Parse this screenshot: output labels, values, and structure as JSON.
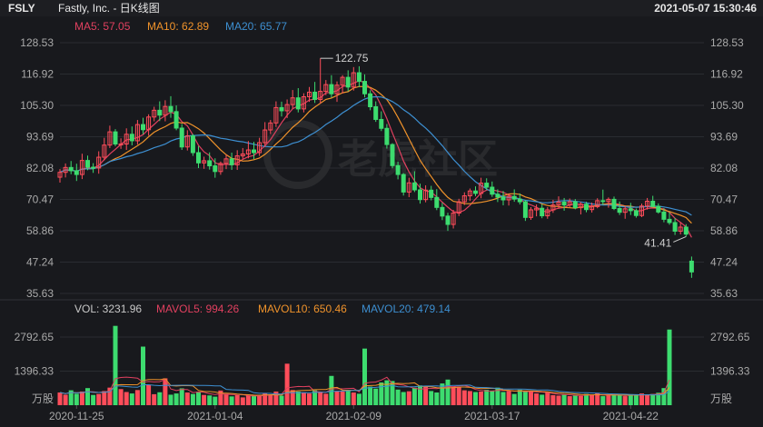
{
  "header": {
    "symbol": "FSLY",
    "title": "Fastly, Inc. - 日K线图",
    "datetime": "2021-05-07 15:30:46"
  },
  "price_legend": [
    {
      "label": "MA5: 57.05",
      "color": "#e0405f"
    },
    {
      "label": "MA10: 62.89",
      "color": "#f0932b"
    },
    {
      "label": "MA20: 65.77",
      "color": "#3d8fd1"
    }
  ],
  "volume_legend": [
    {
      "label": "VOL: 3231.96",
      "color": "#c8c8c8"
    },
    {
      "label": "MAVOL5: 994.26",
      "color": "#e0405f"
    },
    {
      "label": "MAVOL10: 650.46",
      "color": "#f0932b"
    },
    {
      "label": "MAVOL20: 479.14",
      "color": "#3d8fd1"
    }
  ],
  "watermark": "老虎社区",
  "colors": {
    "up": "#ff4d5a",
    "down": "#3ddc6f",
    "grid": "#2a2c31",
    "bg": "#18191d"
  },
  "chart_data": {
    "type": "candlestick",
    "title": "Fastly, Inc. - 日K线图",
    "price_axis": {
      "ticks": [
        "128.53",
        "116.92",
        "105.30",
        "93.69",
        "82.08",
        "70.47",
        "58.86",
        "47.24",
        "35.63"
      ],
      "range": [
        35.63,
        128.53
      ]
    },
    "volume_axis": {
      "ticks": [
        "2792.65",
        "1396.33"
      ],
      "unit": "万股",
      "range": [
        0,
        3350
      ]
    },
    "date_ticks": [
      {
        "index": 3,
        "label": "2020-11-25"
      },
      {
        "index": 28,
        "label": "2021-01-04"
      },
      {
        "index": 53,
        "label": "2021-02-09"
      },
      {
        "index": 78,
        "label": "2021-03-17"
      },
      {
        "index": 103,
        "label": "2021-04-22"
      }
    ],
    "annotations": {
      "high": {
        "index": 47,
        "label": "122.75"
      },
      "low": {
        "index": 113,
        "label": "41.41"
      }
    },
    "candles": [
      {
        "o": 78.7,
        "h": 81.7,
        "l": 76.7,
        "c": 80.5
      },
      {
        "o": 80.5,
        "h": 83.8,
        "l": 78.6,
        "c": 82.3
      },
      {
        "o": 82.3,
        "h": 84.7,
        "l": 79.8,
        "c": 81.1
      },
      {
        "o": 81.1,
        "h": 83.7,
        "l": 77.3,
        "c": 79.7
      },
      {
        "o": 79.7,
        "h": 87.4,
        "l": 78.0,
        "c": 84.9
      },
      {
        "o": 84.9,
        "h": 86.7,
        "l": 81.3,
        "c": 82.4
      },
      {
        "o": 82.4,
        "h": 83.9,
        "l": 80.3,
        "c": 82.1
      },
      {
        "o": 82.1,
        "h": 88.3,
        "l": 80.0,
        "c": 86.1
      },
      {
        "o": 86.1,
        "h": 93.3,
        "l": 85.0,
        "c": 90.6
      },
      {
        "o": 90.6,
        "h": 97.8,
        "l": 89.5,
        "c": 95.5
      },
      {
        "o": 95.5,
        "h": 96.5,
        "l": 90.2,
        "c": 91.0
      },
      {
        "o": 91.0,
        "h": 93.1,
        "l": 89.2,
        "c": 91.0
      },
      {
        "o": 91.0,
        "h": 96.8,
        "l": 88.8,
        "c": 94.6
      },
      {
        "o": 94.6,
        "h": 97.5,
        "l": 90.5,
        "c": 92.2
      },
      {
        "o": 92.2,
        "h": 99.9,
        "l": 90.8,
        "c": 98.2
      },
      {
        "o": 98.2,
        "h": 100.7,
        "l": 94.6,
        "c": 96.3
      },
      {
        "o": 96.3,
        "h": 102.0,
        "l": 94.1,
        "c": 101.0
      },
      {
        "o": 101.0,
        "h": 104.8,
        "l": 99.4,
        "c": 103.5
      },
      {
        "o": 103.5,
        "h": 106.8,
        "l": 99.5,
        "c": 101.7
      },
      {
        "o": 101.7,
        "h": 107.2,
        "l": 99.4,
        "c": 104.9
      },
      {
        "o": 104.9,
        "h": 108.7,
        "l": 100.7,
        "c": 103.0
      },
      {
        "o": 103.0,
        "h": 105.3,
        "l": 96.1,
        "c": 96.9
      },
      {
        "o": 96.9,
        "h": 98.4,
        "l": 88.8,
        "c": 89.9
      },
      {
        "o": 89.9,
        "h": 96.1,
        "l": 88.6,
        "c": 94.0
      },
      {
        "o": 94.0,
        "h": 94.7,
        "l": 86.6,
        "c": 87.8
      },
      {
        "o": 87.8,
        "h": 90.2,
        "l": 82.1,
        "c": 84.0
      },
      {
        "o": 84.0,
        "h": 86.3,
        "l": 81.8,
        "c": 84.8
      },
      {
        "o": 84.8,
        "h": 87.9,
        "l": 81.5,
        "c": 82.9
      },
      {
        "o": 82.9,
        "h": 85.7,
        "l": 78.5,
        "c": 80.8
      },
      {
        "o": 80.8,
        "h": 84.5,
        "l": 79.6,
        "c": 83.8
      },
      {
        "o": 83.8,
        "h": 87.0,
        "l": 81.7,
        "c": 85.5
      },
      {
        "o": 85.5,
        "h": 87.8,
        "l": 81.4,
        "c": 83.3
      },
      {
        "o": 83.3,
        "h": 88.7,
        "l": 81.4,
        "c": 86.6
      },
      {
        "o": 86.6,
        "h": 89.5,
        "l": 85.5,
        "c": 87.3
      },
      {
        "o": 87.3,
        "h": 92.1,
        "l": 85.7,
        "c": 88.8
      },
      {
        "o": 88.8,
        "h": 91.8,
        "l": 85.4,
        "c": 87.8
      },
      {
        "o": 87.8,
        "h": 93.3,
        "l": 86.6,
        "c": 91.5
      },
      {
        "o": 91.5,
        "h": 99.1,
        "l": 89.9,
        "c": 96.2
      },
      {
        "o": 96.2,
        "h": 99.9,
        "l": 94.7,
        "c": 98.8
      },
      {
        "o": 98.8,
        "h": 106.8,
        "l": 97.3,
        "c": 104.5
      },
      {
        "o": 104.5,
        "h": 106.7,
        "l": 101.2,
        "c": 103.3
      },
      {
        "o": 103.3,
        "h": 107.5,
        "l": 100.6,
        "c": 105.6
      },
      {
        "o": 105.6,
        "h": 111.0,
        "l": 104.1,
        "c": 108.1
      },
      {
        "o": 108.1,
        "h": 111.7,
        "l": 102.7,
        "c": 104.0
      },
      {
        "o": 104.0,
        "h": 109.8,
        "l": 102.7,
        "c": 108.5
      },
      {
        "o": 108.5,
        "h": 112.1,
        "l": 106.6,
        "c": 110.2
      },
      {
        "o": 110.2,
        "h": 114.0,
        "l": 106.2,
        "c": 107.5
      },
      {
        "o": 107.5,
        "h": 122.75,
        "l": 106.0,
        "c": 110.5
      },
      {
        "o": 110.5,
        "h": 114.7,
        "l": 109.1,
        "c": 113.0
      },
      {
        "o": 113.0,
        "h": 116.5,
        "l": 108.2,
        "c": 109.6
      },
      {
        "o": 109.6,
        "h": 114.2,
        "l": 106.6,
        "c": 112.8
      },
      {
        "o": 112.8,
        "h": 116.5,
        "l": 109.7,
        "c": 115.7
      },
      {
        "o": 115.7,
        "h": 118.3,
        "l": 110.5,
        "c": 112.1
      },
      {
        "o": 112.1,
        "h": 119.5,
        "l": 110.8,
        "c": 117.4
      },
      {
        "o": 117.4,
        "h": 119.8,
        "l": 112.1,
        "c": 114.2
      },
      {
        "o": 114.2,
        "h": 116.8,
        "l": 108.3,
        "c": 109.6
      },
      {
        "o": 109.6,
        "h": 110.9,
        "l": 103.5,
        "c": 104.8
      },
      {
        "o": 104.8,
        "h": 106.8,
        "l": 99.2,
        "c": 100.1
      },
      {
        "o": 100.1,
        "h": 103.1,
        "l": 95.8,
        "c": 96.8
      },
      {
        "o": 96.8,
        "h": 98.4,
        "l": 89.3,
        "c": 90.8
      },
      {
        "o": 90.8,
        "h": 91.3,
        "l": 82.0,
        "c": 83.0
      },
      {
        "o": 83.0,
        "h": 84.5,
        "l": 77.9,
        "c": 79.7
      },
      {
        "o": 79.7,
        "h": 80.2,
        "l": 71.9,
        "c": 73.2
      },
      {
        "o": 73.2,
        "h": 78.5,
        "l": 71.3,
        "c": 76.6
      },
      {
        "o": 76.6,
        "h": 80.9,
        "l": 73.2,
        "c": 74.0
      },
      {
        "o": 74.0,
        "h": 76.3,
        "l": 68.9,
        "c": 70.4
      },
      {
        "o": 70.4,
        "h": 75.7,
        "l": 69.4,
        "c": 73.9
      },
      {
        "o": 73.9,
        "h": 75.5,
        "l": 70.1,
        "c": 71.2
      },
      {
        "o": 71.2,
        "h": 74.3,
        "l": 66.5,
        "c": 67.5
      },
      {
        "o": 67.5,
        "h": 69.2,
        "l": 62.8,
        "c": 64.3
      },
      {
        "o": 64.3,
        "h": 65.5,
        "l": 58.8,
        "c": 61.2
      },
      {
        "o": 61.2,
        "h": 66.6,
        "l": 59.7,
        "c": 65.4
      },
      {
        "o": 65.4,
        "h": 70.7,
        "l": 64.3,
        "c": 69.6
      },
      {
        "o": 69.6,
        "h": 73.1,
        "l": 68.4,
        "c": 71.8
      },
      {
        "o": 71.8,
        "h": 74.5,
        "l": 69.9,
        "c": 73.6
      },
      {
        "o": 73.6,
        "h": 75.3,
        "l": 71.7,
        "c": 72.7
      },
      {
        "o": 72.7,
        "h": 78.5,
        "l": 70.9,
        "c": 76.5
      },
      {
        "o": 76.5,
        "h": 78.3,
        "l": 73.9,
        "c": 75.0
      },
      {
        "o": 75.0,
        "h": 77.1,
        "l": 71.4,
        "c": 72.4
      },
      {
        "o": 72.4,
        "h": 74.2,
        "l": 69.5,
        "c": 71.3
      },
      {
        "o": 71.3,
        "h": 73.6,
        "l": 68.3,
        "c": 70.3
      },
      {
        "o": 70.3,
        "h": 72.5,
        "l": 68.2,
        "c": 71.6
      },
      {
        "o": 71.6,
        "h": 74.2,
        "l": 69.6,
        "c": 70.6
      },
      {
        "o": 70.6,
        "h": 72.7,
        "l": 68.6,
        "c": 69.6
      },
      {
        "o": 69.6,
        "h": 70.3,
        "l": 62.5,
        "c": 63.8
      },
      {
        "o": 63.8,
        "h": 67.6,
        "l": 62.9,
        "c": 66.6
      },
      {
        "o": 66.6,
        "h": 68.6,
        "l": 64.2,
        "c": 67.2
      },
      {
        "o": 67.2,
        "h": 68.7,
        "l": 63.5,
        "c": 64.4
      },
      {
        "o": 64.4,
        "h": 67.6,
        "l": 63.3,
        "c": 66.6
      },
      {
        "o": 66.6,
        "h": 70.3,
        "l": 65.5,
        "c": 68.4
      },
      {
        "o": 68.4,
        "h": 71.6,
        "l": 67.0,
        "c": 69.5
      },
      {
        "o": 69.5,
        "h": 71.0,
        "l": 66.3,
        "c": 68.4
      },
      {
        "o": 68.4,
        "h": 70.8,
        "l": 67.4,
        "c": 69.6
      },
      {
        "o": 69.6,
        "h": 70.6,
        "l": 66.8,
        "c": 67.4
      },
      {
        "o": 67.4,
        "h": 69.5,
        "l": 64.9,
        "c": 68.7
      },
      {
        "o": 68.7,
        "h": 69.6,
        "l": 65.7,
        "c": 66.7
      },
      {
        "o": 66.7,
        "h": 69.3,
        "l": 65.6,
        "c": 67.8
      },
      {
        "o": 67.8,
        "h": 70.9,
        "l": 67.2,
        "c": 70.0
      },
      {
        "o": 70.0,
        "h": 74.1,
        "l": 68.4,
        "c": 69.7
      },
      {
        "o": 69.7,
        "h": 71.2,
        "l": 67.4,
        "c": 70.5
      },
      {
        "o": 70.5,
        "h": 71.5,
        "l": 66.5,
        "c": 67.1
      },
      {
        "o": 67.1,
        "h": 69.7,
        "l": 64.7,
        "c": 65.7
      },
      {
        "o": 65.7,
        "h": 68.2,
        "l": 63.3,
        "c": 67.0
      },
      {
        "o": 67.0,
        "h": 69.2,
        "l": 64.7,
        "c": 66.3
      },
      {
        "o": 66.3,
        "h": 67.1,
        "l": 63.7,
        "c": 64.5
      },
      {
        "o": 64.5,
        "h": 68.9,
        "l": 63.9,
        "c": 68.0
      },
      {
        "o": 68.0,
        "h": 71.0,
        "l": 66.7,
        "c": 69.8
      },
      {
        "o": 69.8,
        "h": 71.8,
        "l": 67.5,
        "c": 67.9
      },
      {
        "o": 67.9,
        "h": 69.0,
        "l": 65.2,
        "c": 65.8
      },
      {
        "o": 65.8,
        "h": 67.2,
        "l": 62.0,
        "c": 63.1
      },
      {
        "o": 63.1,
        "h": 65.7,
        "l": 61.1,
        "c": 61.9
      },
      {
        "o": 61.9,
        "h": 63.6,
        "l": 57.3,
        "c": 58.7
      },
      {
        "o": 58.7,
        "h": 62.0,
        "l": 57.5,
        "c": 60.2
      },
      {
        "o": 60.2,
        "h": 61.3,
        "l": 56.7,
        "c": 57.6
      },
      {
        "o": 47.6,
        "h": 49.3,
        "l": 41.41,
        "c": 43.6
      }
    ],
    "volume": [
      520,
      430,
      610,
      470,
      560,
      700,
      420,
      460,
      580,
      720,
      3250,
      660,
      540,
      480,
      620,
      2400,
      820,
      450,
      530,
      1100,
      430,
      480,
      690,
      520,
      460,
      550,
      420,
      400,
      350,
      600,
      470,
      360,
      410,
      320,
      390,
      420,
      380,
      480,
      440,
      560,
      390,
      1700,
      620,
      560,
      520,
      480,
      610,
      540,
      470,
      1200,
      580,
      560,
      610,
      520,
      470,
      2320,
      760,
      680,
      930,
      1020,
      990,
      640,
      540,
      570,
      720,
      810,
      760,
      580,
      520,
      890,
      1050,
      760,
      730,
      610,
      580,
      540,
      560,
      630,
      590,
      720,
      540,
      580,
      460,
      630,
      590,
      560,
      480,
      430,
      530,
      410,
      390,
      440,
      370,
      420,
      380,
      460,
      430,
      490,
      370,
      400,
      430,
      410,
      370,
      450,
      410,
      480,
      420,
      460,
      510,
      700,
      3100
    ]
  }
}
